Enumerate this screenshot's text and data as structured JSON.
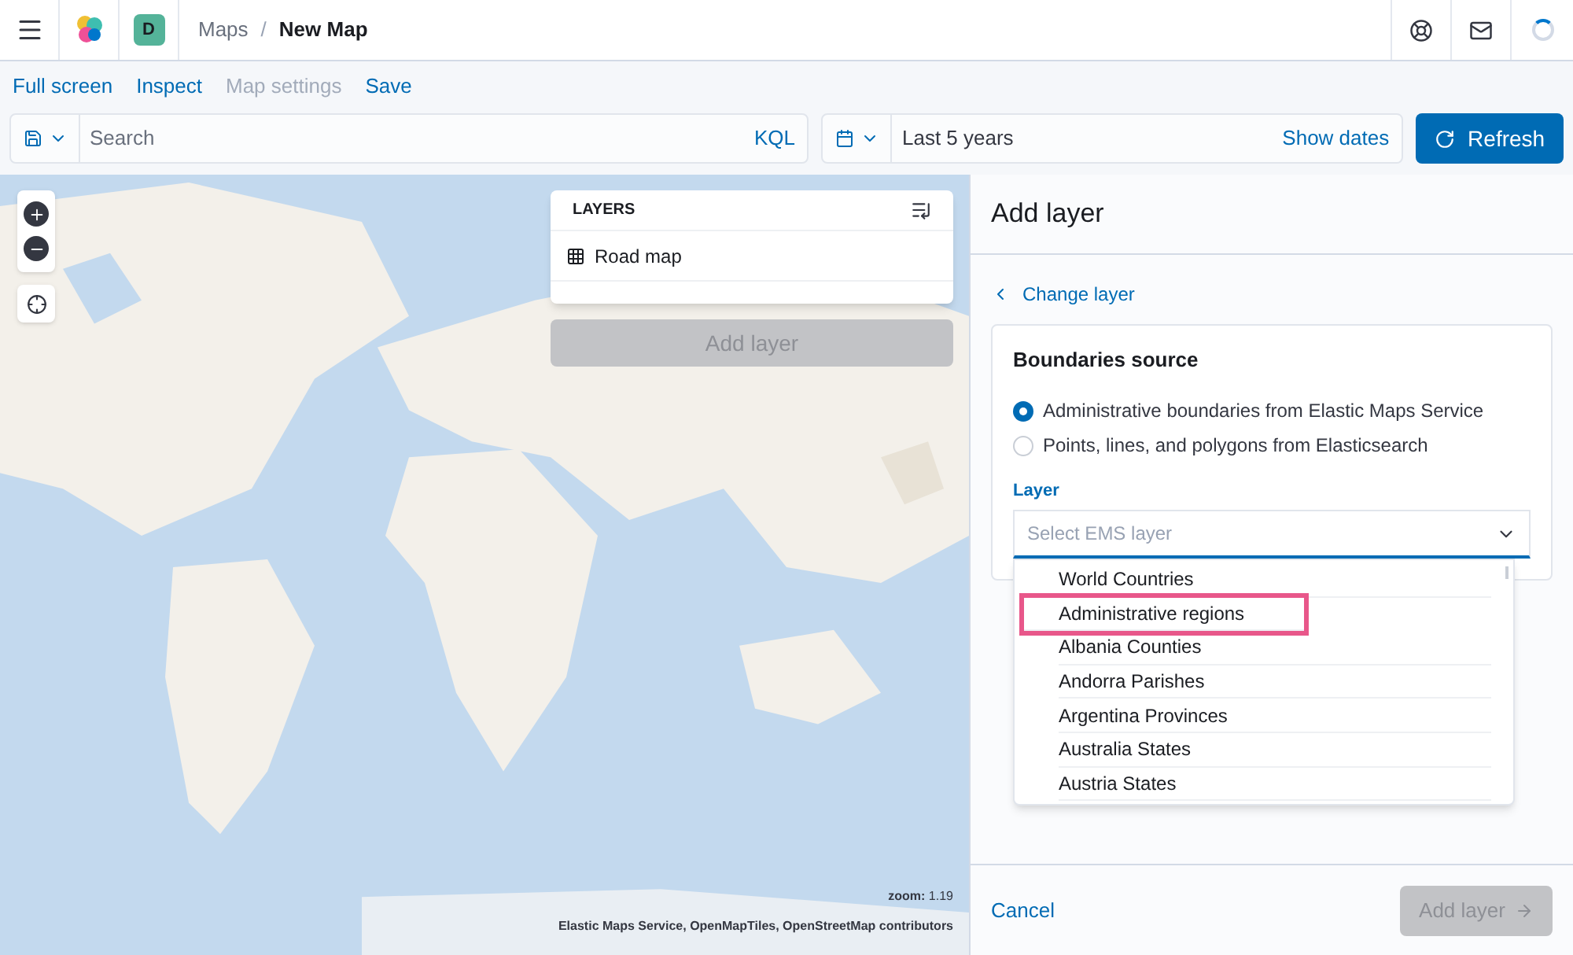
{
  "header": {
    "avatar": "D",
    "separator": "/",
    "breadcrumbs": [
      {
        "label": "Maps",
        "current": false
      },
      {
        "label": "New Map",
        "current": true
      }
    ]
  },
  "top_nav": [
    {
      "label": "Full screen",
      "disabled": false
    },
    {
      "label": "Inspect",
      "disabled": false
    },
    {
      "label": "Map settings",
      "disabled": true
    },
    {
      "label": "Save",
      "disabled": false
    }
  ],
  "query_bar": {
    "placeholder": "Search",
    "language": "KQL",
    "time_range": "Last 5 years",
    "show_dates": "Show dates",
    "refresh": "Refresh"
  },
  "map": {
    "kind": "picture",
    "layers_panel": {
      "title": "LAYERS",
      "layers": [
        {
          "name": "Road map"
        }
      ],
      "add_button": "Add layer",
      "add_disabled": true
    },
    "zoom_label": "**zoom:** 1.19",
    "attribution": "Elastic Maps Service, OpenMapTiles, OpenStreetMap contributors"
  },
  "flyout": {
    "title": "Add layer",
    "back_link": "Change layer",
    "source_title": "Boundaries source",
    "sources": [
      {
        "label": "Administrative boundaries from Elastic Maps Service",
        "selected": true
      },
      {
        "label": "Points, lines, and polygons from Elasticsearch",
        "selected": false
      }
    ],
    "layer_label": "Layer",
    "layer_placeholder": "Select EMS layer",
    "options": [
      {
        "label": "World Countries",
        "highlighted": false
      },
      {
        "label": "Administrative regions",
        "highlighted": true
      },
      {
        "label": "Albania Counties",
        "highlighted": false
      },
      {
        "label": "Andorra Parishes",
        "highlighted": false
      },
      {
        "label": "Argentina Provinces",
        "highlighted": false
      },
      {
        "label": "Australia States",
        "highlighted": false
      },
      {
        "label": "Austria States",
        "highlighted": false
      }
    ],
    "cancel": "Cancel",
    "submit": "Add layer",
    "submit_disabled": true
  }
}
